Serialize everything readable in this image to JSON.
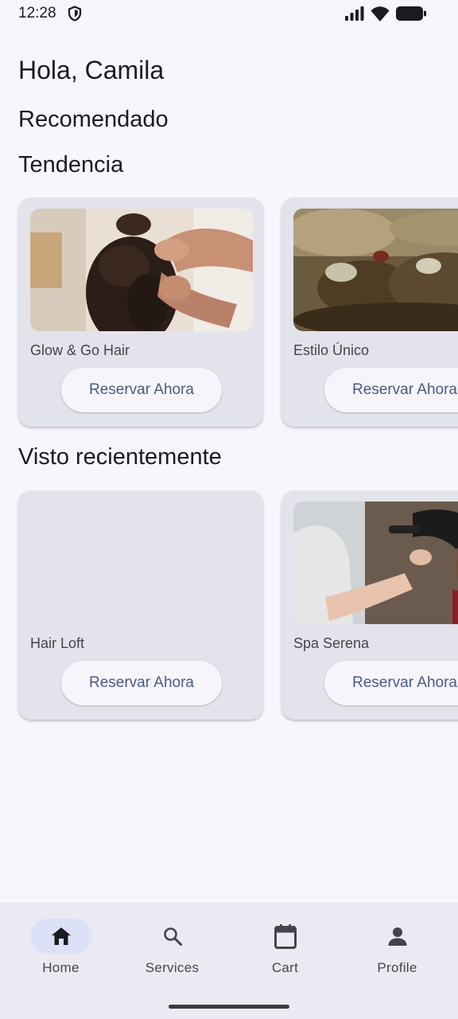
{
  "status_bar": {
    "time": "12:28"
  },
  "header": {
    "greeting": "Hola, Camila"
  },
  "sections": {
    "recommended": "Recomendado",
    "trending": "Tendencia",
    "recent": "Visto recientemente"
  },
  "trending_cards": [
    {
      "name": "Glow & Go Hair",
      "button": "Reservar Ahora",
      "image": "hair-styling-photo"
    },
    {
      "name": "Estilo Único",
      "button": "Reservar Ahora",
      "image": "battle-painting"
    }
  ],
  "recent_cards": [
    {
      "name": "Hair Loft",
      "button": "Reservar Ahora",
      "image": "none"
    },
    {
      "name": "Spa Serena",
      "button": "Reservar Ahora",
      "image": "hair-drying-photo"
    }
  ],
  "bottom_nav": {
    "items": [
      {
        "label": "Home",
        "icon": "home-icon",
        "active": true
      },
      {
        "label": "Services",
        "icon": "search-icon",
        "active": false
      },
      {
        "label": "Cart",
        "icon": "calendar-icon",
        "active": false
      },
      {
        "label": "Profile",
        "icon": "person-icon",
        "active": false
      }
    ]
  },
  "colors": {
    "background": "#f8f6fc",
    "card": "#e3e3ec",
    "button_text": "#4b5a85",
    "nav_active": "#dce1f8"
  }
}
